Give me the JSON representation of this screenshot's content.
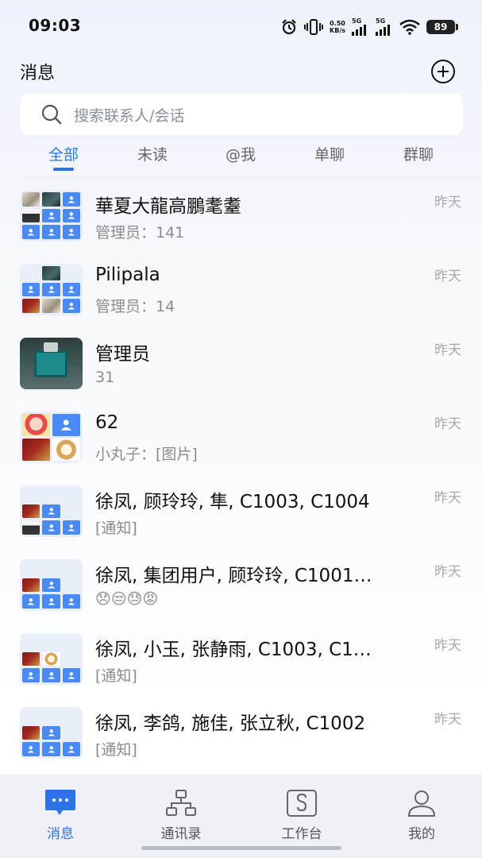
{
  "status_bar": {
    "time": "09:03",
    "net_speed_value": "0.50",
    "net_speed_unit": "KB/s",
    "signal1": "5G",
    "signal2": "5G",
    "battery": "89",
    "icons": [
      "alarm-icon",
      "vibrate-icon",
      "signal-icon",
      "wifi-icon",
      "battery-icon"
    ]
  },
  "header": {
    "title": "消息",
    "add_icon": "plus-circle-icon"
  },
  "search": {
    "placeholder": "搜索联系人/会话",
    "icon": "search-icon"
  },
  "tabs": [
    {
      "label": "全部",
      "active": true
    },
    {
      "label": "未读",
      "active": false
    },
    {
      "label": "@我",
      "active": false
    },
    {
      "label": "单聊",
      "active": false
    },
    {
      "label": "群聊",
      "active": false
    }
  ],
  "conversations": [
    {
      "name": "華夏大龍高鵬耄耋",
      "preview": "管理员：141",
      "time": "昨天"
    },
    {
      "name": "Pilipala",
      "preview": "管理员：14",
      "time": "昨天"
    },
    {
      "name": "管理员",
      "preview": "31",
      "time": "昨天"
    },
    {
      "name": "62",
      "preview": "小丸子：[图片]",
      "time": "昨天"
    },
    {
      "name": "徐凤, 顾玲玲, 隼, C1003, C1004",
      "preview": "[通知]",
      "time": "昨天"
    },
    {
      "name": "徐凤, 集团用户, 顾玲玲, C1001…",
      "preview": "😞😒😓😡",
      "time": "昨天"
    },
    {
      "name": "徐凤, 小玉, 张静雨, C1003, C1…",
      "preview": "[通知]",
      "time": "昨天"
    },
    {
      "name": "徐凤, 李鸽, 施佳, 张立秋, C1002",
      "preview": "[通知]",
      "time": "昨天"
    }
  ],
  "bottom_nav": [
    {
      "label": "消息",
      "icon": "chat-bubble-icon",
      "active": true
    },
    {
      "label": "通讯录",
      "icon": "org-chart-icon",
      "active": false
    },
    {
      "label": "工作台",
      "icon": "workbench-icon",
      "active": false
    },
    {
      "label": "我的",
      "icon": "person-icon",
      "active": false
    }
  ],
  "colors": {
    "accent": "#2b73e6",
    "avatar_blue": "#4a8af4"
  }
}
